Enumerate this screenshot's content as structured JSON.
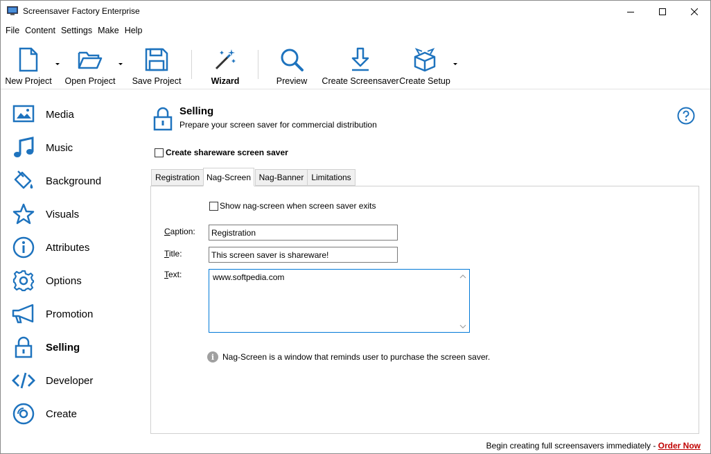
{
  "window": {
    "title": "Screensaver Factory Enterprise"
  },
  "menu": [
    "File",
    "Content",
    "Settings",
    "Make",
    "Help"
  ],
  "toolbar": {
    "new_project": "New Project",
    "open_project": "Open Project",
    "save_project": "Save Project",
    "wizard": "Wizard",
    "preview": "Preview",
    "create_screensaver": "Create Screensaver",
    "create_setup": "Create Setup"
  },
  "sidebar": {
    "items": [
      {
        "label": "Media",
        "icon": "image-icon"
      },
      {
        "label": "Music",
        "icon": "music-note-icon"
      },
      {
        "label": "Background",
        "icon": "paint-bucket-icon"
      },
      {
        "label": "Visuals",
        "icon": "star-icon"
      },
      {
        "label": "Attributes",
        "icon": "info-circle-icon"
      },
      {
        "label": "Options",
        "icon": "gear-icon"
      },
      {
        "label": "Promotion",
        "icon": "megaphone-icon"
      },
      {
        "label": "Selling",
        "icon": "lock-icon",
        "active": true
      },
      {
        "label": "Developer",
        "icon": "code-icon"
      },
      {
        "label": "Create",
        "icon": "disc-icon"
      }
    ]
  },
  "section": {
    "title": "Selling",
    "subtitle": "Prepare your screen saver for commercial distribution",
    "shareware_checkbox": "Create shareware screen saver"
  },
  "tabs": [
    {
      "label": "Registration"
    },
    {
      "label": "Nag-Screen",
      "active": true
    },
    {
      "label": "Nag-Banner"
    },
    {
      "label": "Limitations"
    }
  ],
  "nag": {
    "show_checkbox": "Show nag-screen when screen saver exits",
    "caption_label_prefix": "",
    "caption_label_u": "C",
    "caption_label_rest": "aption:",
    "caption_value": "Registration",
    "title_label_u": "T",
    "title_label_rest": "itle:",
    "title_value": "This screen saver is shareware!",
    "text_label_u": "T",
    "text_label_rest": "ext:",
    "text_value": "www.softpedia.com",
    "info": "Nag-Screen is a window that reminds user to purchase the screen saver."
  },
  "footer": {
    "text": "Begin creating full screensavers immediately - ",
    "link": "Order Now"
  },
  "colors": {
    "accent": "#1e73be",
    "link": "#c00000",
    "focus": "#0078d7"
  }
}
